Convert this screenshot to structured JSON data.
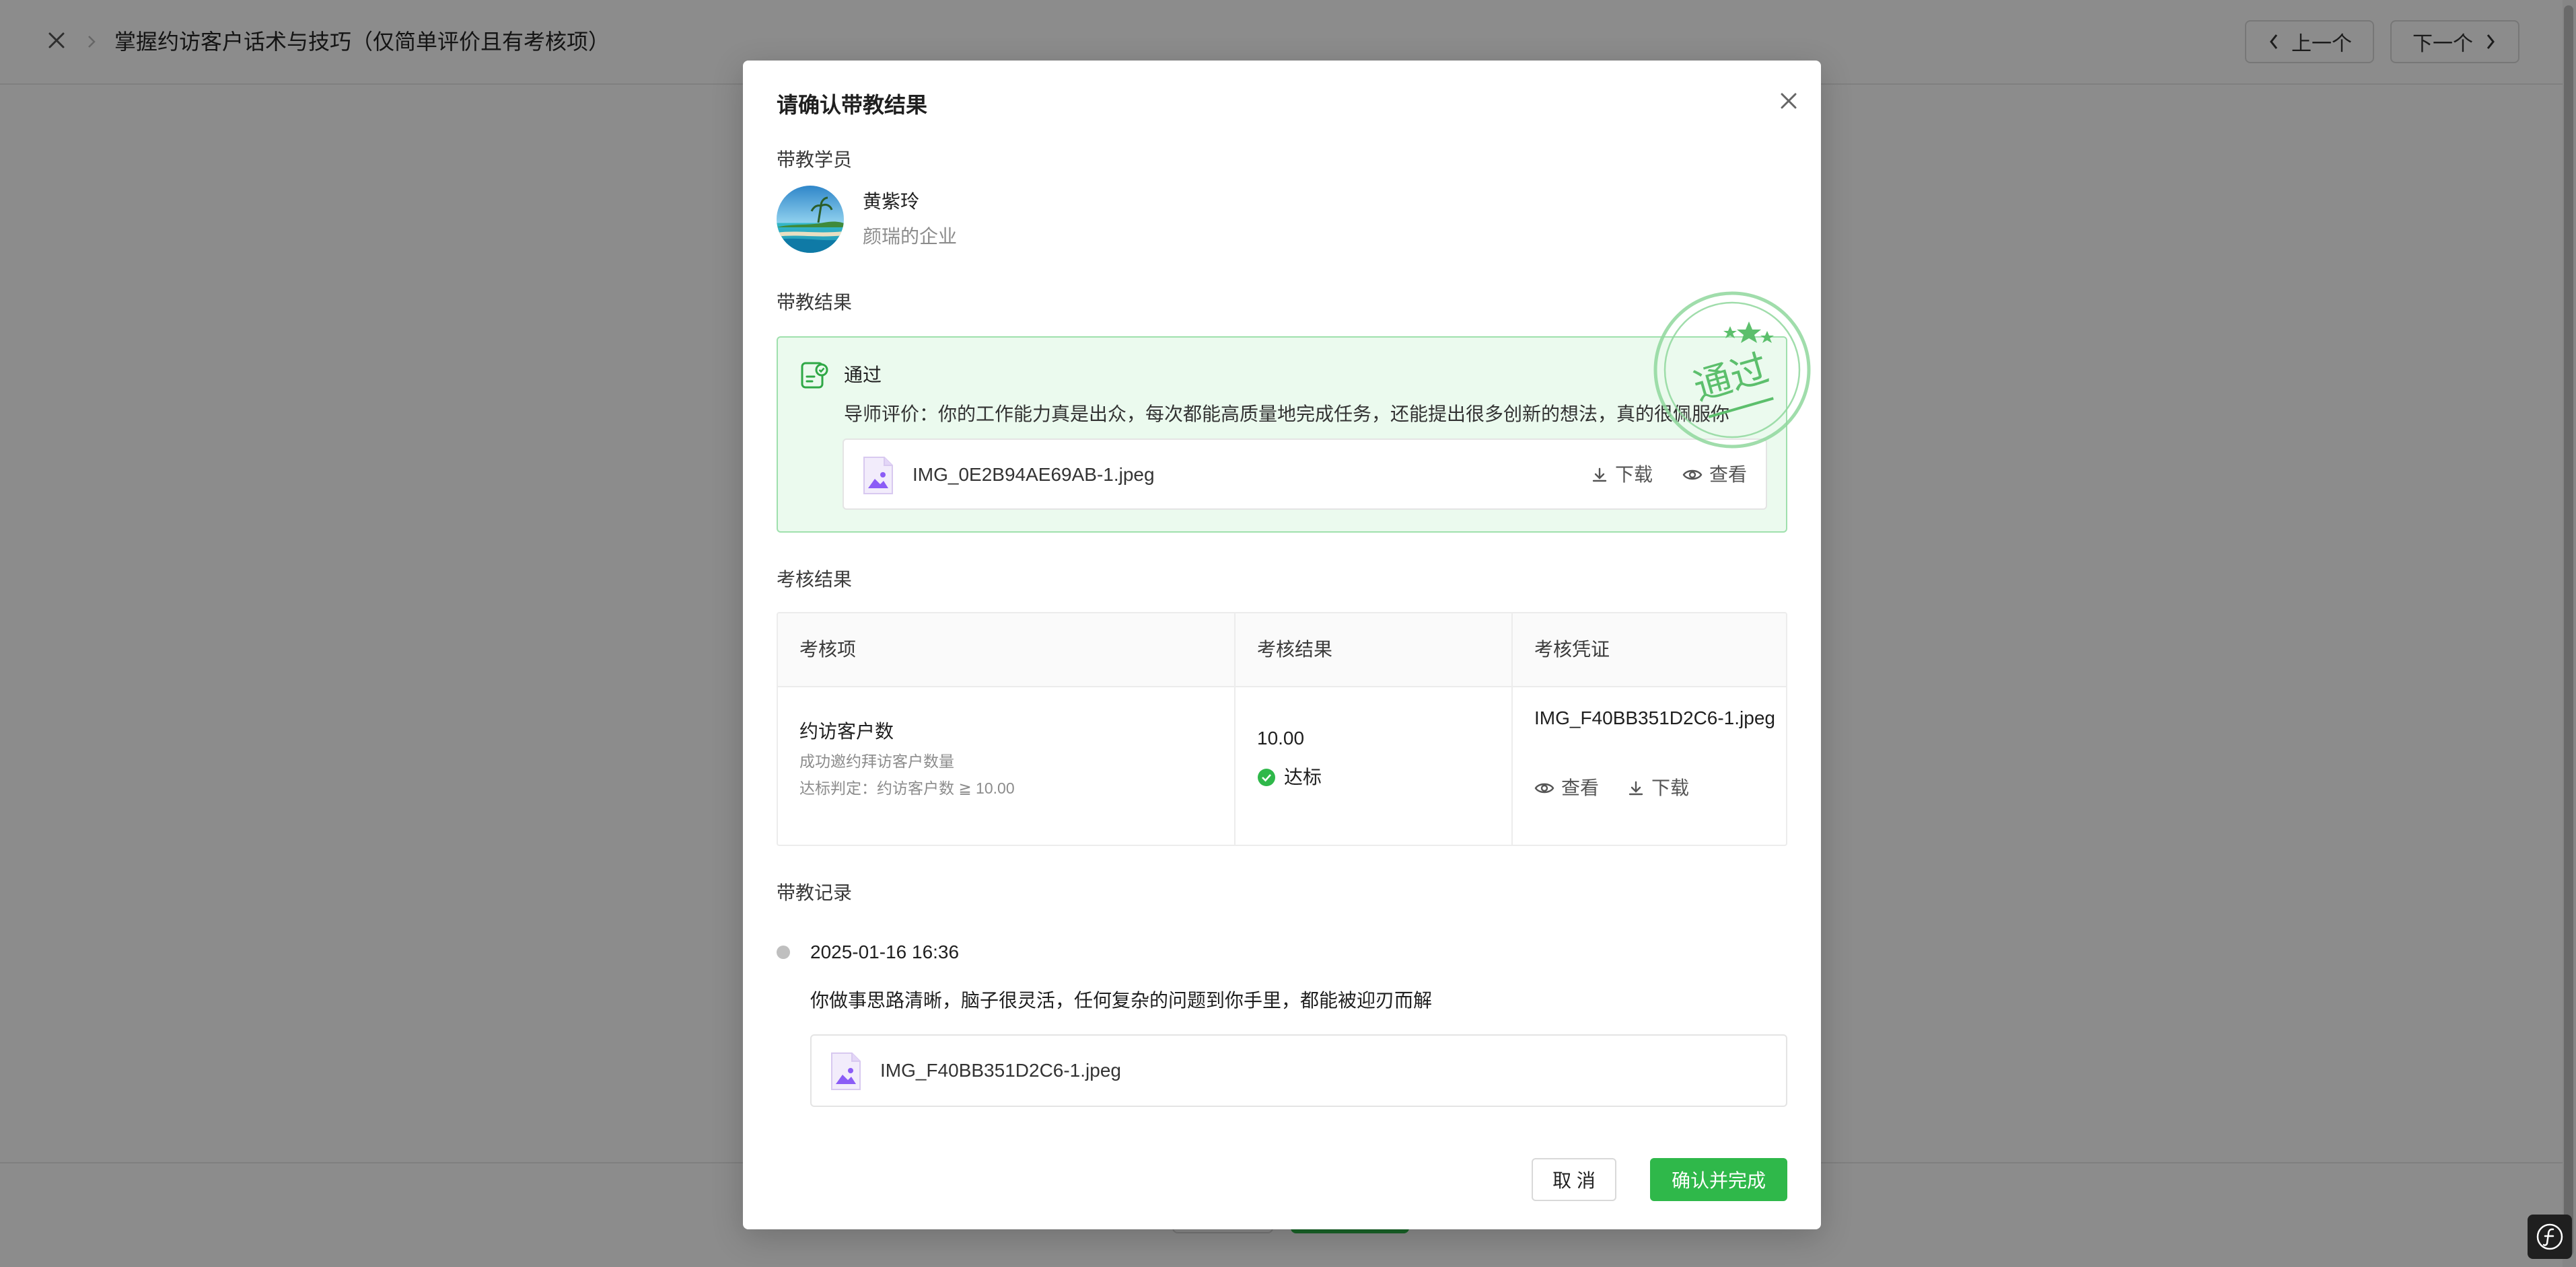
{
  "background": {
    "page_title": "掌握约访客户话术与技巧（仅简单评价且有考核项）",
    "prev_label": "上一个",
    "next_label": "下一个"
  },
  "modal": {
    "title": "请确认带教结果",
    "student_section_label": "带教学员",
    "student": {
      "name": "黄紫玲",
      "org": "颜瑞的企业"
    },
    "result_section_label": "带教结果",
    "result": {
      "status": "通过",
      "mentor_comment": "导师评价：你的工作能力真是出众，每次都能高质量地完成任务，还能提出很多创新的想法，真的很佩服你",
      "file_name": "IMG_0E2B94AE69AB-1.jpeg",
      "download_label": "下载",
      "view_label": "查看",
      "stamp_text": "通过"
    },
    "exam_section_label": "考核结果",
    "exam_table": {
      "headers": [
        "考核项",
        "考核结果",
        "考核凭证"
      ],
      "rows": [
        {
          "item_name": "约访客户数",
          "item_desc": "成功邀约拜访客户数量",
          "item_rule": "达标判定：约访客户数  ≧  10.00",
          "value": "10.00",
          "status": "达标",
          "cert_file": "IMG_F40BB351D2C6-1.jpeg",
          "view_label": "查看",
          "download_label": "下载"
        }
      ]
    },
    "record_section_label": "带教记录",
    "record": {
      "time": "2025-01-16 16:36",
      "content": "你做事思路清晰，脑子很灵活，任何复杂的问题到你手里，都能被迎刃而解",
      "file_name": "IMG_F40BB351D2C6-1.jpeg"
    },
    "cancel_label": "取 消",
    "confirm_label": "确认并完成"
  },
  "colors": {
    "primary": "#2fb84a",
    "result_bg": "#ebfaee",
    "result_border": "#9fe0ad",
    "mask": "rgba(0,0,0,0.45)"
  },
  "icons": {
    "close": "close-icon",
    "prev": "chevron-left-icon",
    "next": "chevron-right-icon",
    "result": "checklist-icon",
    "file": "image-file-icon",
    "download": "download-icon",
    "view": "eye-icon",
    "pass": "check-circle-icon"
  }
}
